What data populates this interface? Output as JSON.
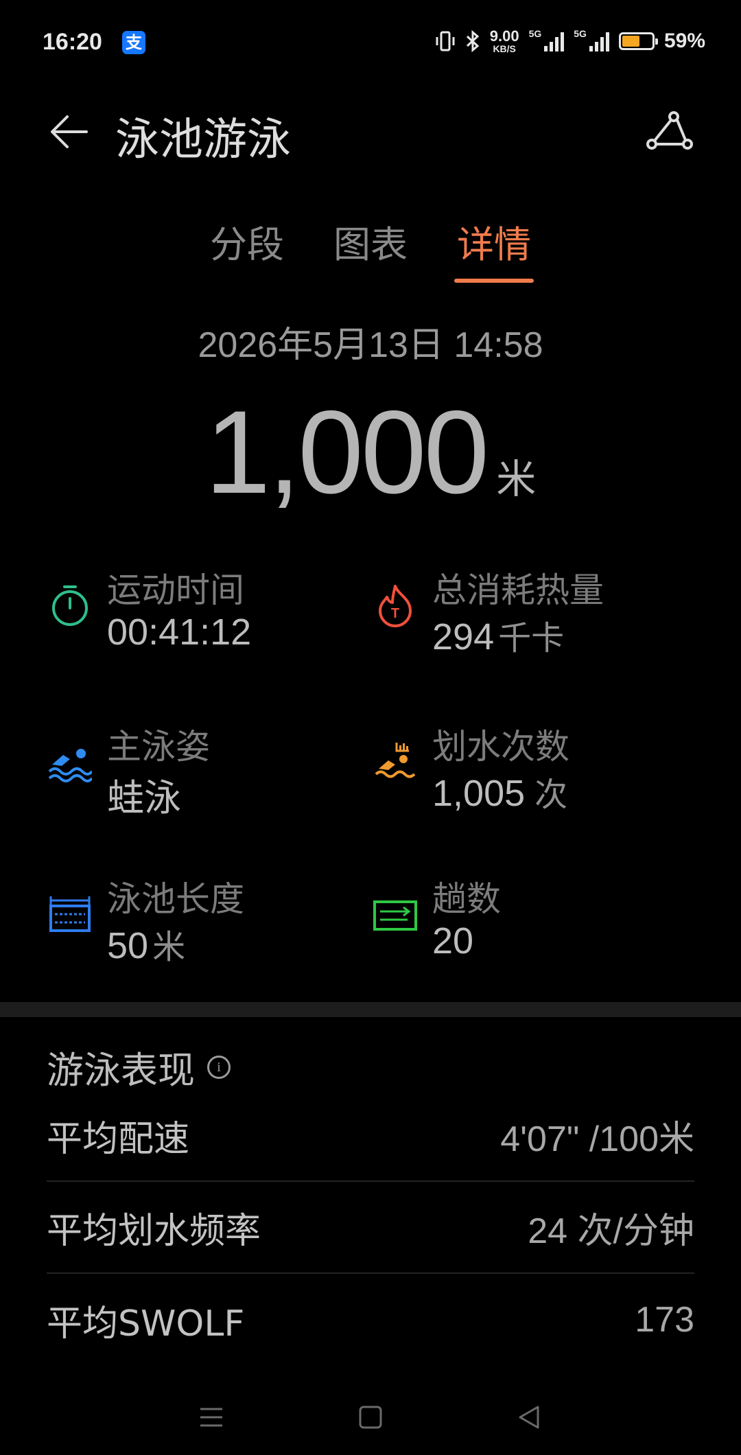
{
  "status_bar": {
    "time": "16:20",
    "alipay_glyph": "支",
    "net_speed": "9.00",
    "net_speed_unit": "KB/S",
    "sim1_label": "5G",
    "sim2_label": "5G",
    "battery": "59%",
    "battery_level": 0.59
  },
  "header": {
    "title": "泳池游泳",
    "back_icon": "arrow-left-icon",
    "route_icon": "route-icon"
  },
  "tabs": [
    {
      "label": "分段",
      "active": false
    },
    {
      "label": "图表",
      "active": false
    },
    {
      "label": "详情",
      "active": true
    }
  ],
  "summary": {
    "datetime": "2026年5月13日 14:58",
    "distance": "1,000",
    "distance_unit": "米"
  },
  "metrics": {
    "duration": {
      "label": "运动时间",
      "value": "00:41:12",
      "icon": "stopwatch-icon",
      "color": "#2fbf8a"
    },
    "calories": {
      "label": "总消耗热量",
      "value": "294",
      "unit": "千卡",
      "icon": "flame-icon",
      "color": "#f0503c"
    },
    "stroke": {
      "label": "主泳姿",
      "value": "蛙泳",
      "icon": "swimmer-icon",
      "color": "#2f8cf0"
    },
    "stroke_count": {
      "label": "划水次数",
      "value": "1,005",
      "unit": "次",
      "icon": "swim-strokes-icon",
      "color": "#f09a2f"
    },
    "pool_length": {
      "label": "泳池长度",
      "value": "50",
      "unit": "米",
      "icon": "pool-icon",
      "color": "#2f7cf0"
    },
    "laps": {
      "label": "趟数",
      "value": "20",
      "icon": "laps-icon",
      "color": "#2fc844"
    }
  },
  "performance": {
    "title": "游泳表现",
    "rows": [
      {
        "label": "平均配速",
        "value": "4'07\" /100米"
      },
      {
        "label": "平均划水频率",
        "value": "24 次/分钟"
      },
      {
        "label": "平均SWOLF",
        "value": "173"
      }
    ]
  },
  "nav": {
    "menu_icon": "menu-icon",
    "home_icon": "square-home-icon",
    "back_icon": "triangle-back-icon"
  }
}
